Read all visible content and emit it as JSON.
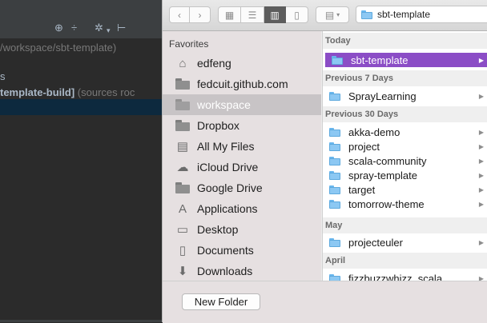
{
  "ide": {
    "path_text": "/workspace/sbt-template)",
    "line_letter": "s",
    "build_label": "template-build]",
    "sources_text": "(sources roc"
  },
  "toolbar": {
    "path_value": "sbt-template"
  },
  "sidebar": {
    "heading": "Favorites",
    "items": [
      {
        "label": "edfeng",
        "icon": "home-icon"
      },
      {
        "label": "fedcuit.github.com",
        "icon": "folder-icon"
      },
      {
        "label": "workspace",
        "icon": "folder-icon",
        "selected": true
      },
      {
        "label": "Dropbox",
        "icon": "folder-icon"
      },
      {
        "label": "All My Files",
        "icon": "all-files-icon"
      },
      {
        "label": "iCloud Drive",
        "icon": "cloud-icon"
      },
      {
        "label": "Google Drive",
        "icon": "folder-icon"
      },
      {
        "label": "Applications",
        "icon": "applications-icon"
      },
      {
        "label": "Desktop",
        "icon": "desktop-icon"
      },
      {
        "label": "Documents",
        "icon": "documents-icon"
      },
      {
        "label": "Downloads",
        "icon": "downloads-icon"
      }
    ]
  },
  "filelist": {
    "groups": [
      {
        "title": "Today",
        "items": [
          "sbt-template"
        ]
      },
      {
        "title": "Previous 7 Days",
        "items": [
          "SprayLearning"
        ]
      },
      {
        "title": "Previous 30 Days",
        "items": [
          "akka-demo",
          "project",
          "scala-community",
          "spray-template",
          "target",
          "tomorrow-theme"
        ]
      },
      {
        "title": "May",
        "items": [
          "projecteuler"
        ]
      },
      {
        "title": "April",
        "items": [
          "fizzbuzzwhizz_scala"
        ]
      }
    ]
  },
  "bottom": {
    "new_folder_label": "New Folder"
  },
  "colors": {
    "selection": "#8b4dc6",
    "sidebar_bg": "#e6e0e1",
    "ide_bg": "#2b2b2b"
  }
}
